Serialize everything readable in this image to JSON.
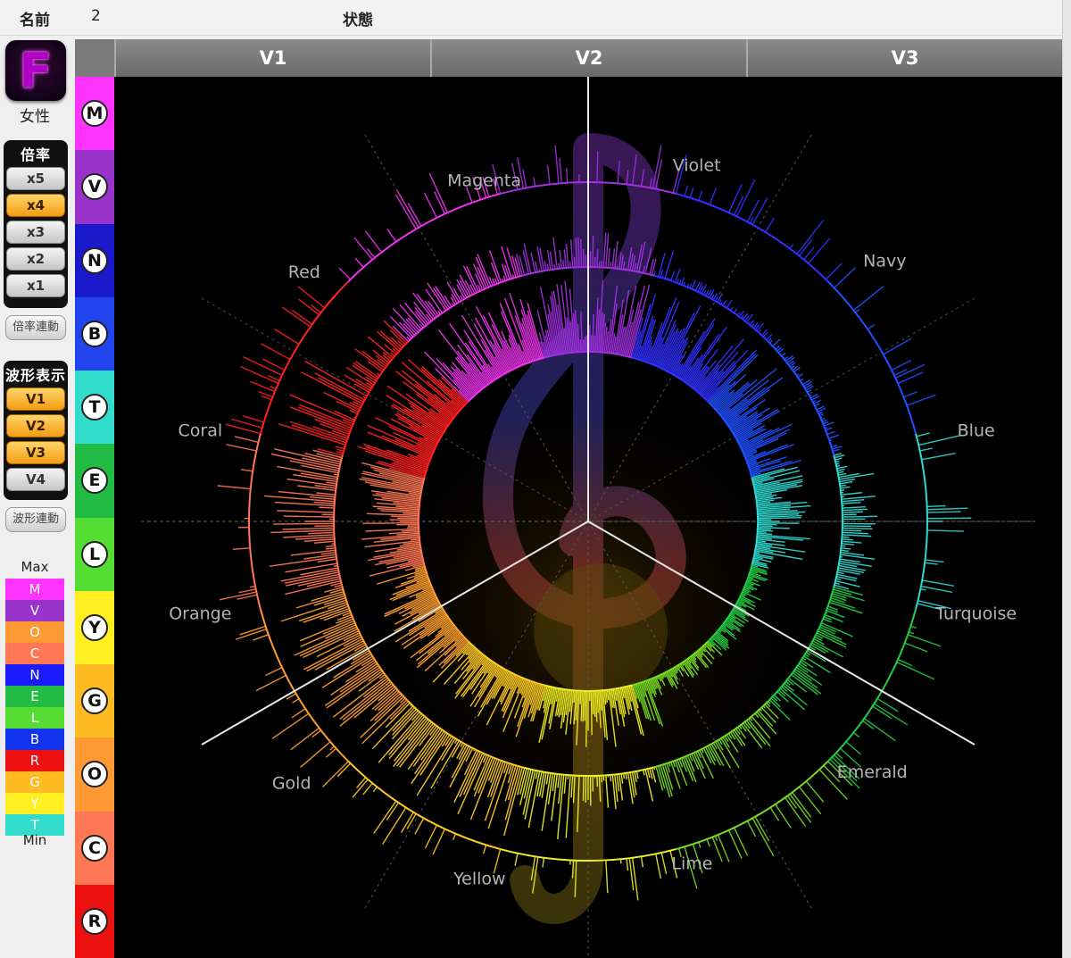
{
  "topbar": {
    "name_label": "名前",
    "name_value": "2",
    "status_label": "状態"
  },
  "sidebar": {
    "logo_letter": "F",
    "gender": "女性",
    "magnification": {
      "title": "倍率",
      "buttons": [
        "x5",
        "x4",
        "x3",
        "x2",
        "x1"
      ],
      "active": "x4"
    },
    "magnification_link": "倍率連動",
    "waveform": {
      "title": "波形表示",
      "buttons": [
        "V1",
        "V2",
        "V3",
        "V4"
      ],
      "active": [
        "V1",
        "V2",
        "V3"
      ]
    },
    "waveform_link": "波形連動",
    "legend": {
      "max_label": "Max",
      "min_label": "Min",
      "items": [
        {
          "letter": "M",
          "color": "#ff33ff"
        },
        {
          "letter": "V",
          "color": "#9933cc"
        },
        {
          "letter": "O",
          "color": "#ff9933"
        },
        {
          "letter": "C",
          "color": "#ff7755"
        },
        {
          "letter": "N",
          "color": "#1a1aff"
        },
        {
          "letter": "E",
          "color": "#22bb44"
        },
        {
          "letter": "L",
          "color": "#55dd33"
        },
        {
          "letter": "B",
          "color": "#1133ee"
        },
        {
          "letter": "R",
          "color": "#ee1111"
        },
        {
          "letter": "G",
          "color": "#ffbb22"
        },
        {
          "letter": "Y",
          "color": "#ffee22"
        },
        {
          "letter": "T",
          "color": "#33ddcc"
        }
      ]
    }
  },
  "colorbar": [
    {
      "letter": "M",
      "color": "#ff33ff"
    },
    {
      "letter": "V",
      "color": "#9933cc"
    },
    {
      "letter": "N",
      "color": "#1a1acc"
    },
    {
      "letter": "B",
      "color": "#2244ee"
    },
    {
      "letter": "T",
      "color": "#33ddcc"
    },
    {
      "letter": "E",
      "color": "#22bb44"
    },
    {
      "letter": "L",
      "color": "#55dd33"
    },
    {
      "letter": "Y",
      "color": "#ffee22"
    },
    {
      "letter": "G",
      "color": "#ffbb22"
    },
    {
      "letter": "O",
      "color": "#ff9933"
    },
    {
      "letter": "C",
      "color": "#ff7755"
    },
    {
      "letter": "R",
      "color": "#ee1111"
    }
  ],
  "columns": [
    "V1",
    "V2",
    "V3"
  ],
  "wheel": {
    "sectors": [
      {
        "name": "Violet",
        "color": "#a030e0"
      },
      {
        "name": "Navy",
        "color": "#3030ff"
      },
      {
        "name": "Blue",
        "color": "#2050ff"
      },
      {
        "name": "Turquoise",
        "color": "#30d8d0"
      },
      {
        "name": "Emerald",
        "color": "#22cc44"
      },
      {
        "name": "Lime",
        "color": "#77dd22"
      },
      {
        "name": "Yellow",
        "color": "#eeee22"
      },
      {
        "name": "Gold",
        "color": "#ffcc22"
      },
      {
        "name": "Orange",
        "color": "#ffa030"
      },
      {
        "name": "Coral",
        "color": "#ff7755"
      },
      {
        "name": "Red",
        "color": "#ff2020"
      },
      {
        "name": "Magenta",
        "color": "#ee33ee"
      }
    ]
  }
}
